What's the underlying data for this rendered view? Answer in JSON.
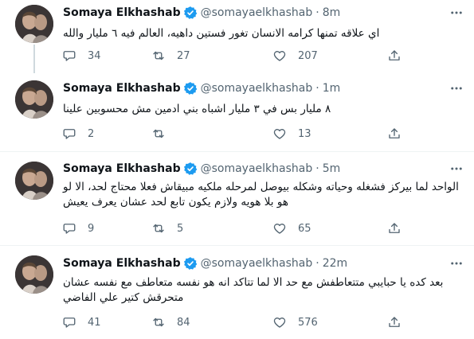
{
  "tweets": [
    {
      "name": "Somaya Elkhashab",
      "handle": "@somayaelkhashab",
      "dot": "·",
      "time": "8m",
      "text": "اي علاقه تمنها كرامه الانسان تغور فستين داهيه، العالم فيه ٦ مليار والله",
      "replies": "34",
      "retweets": "27",
      "likes": "207"
    },
    {
      "name": "Somaya Elkhashab",
      "handle": "@somayaelkhashab",
      "dot": "·",
      "time": "1m",
      "text": "٨ مليار بس في ٣ مليار اشباه بني ادمين مش محسوبين علينا",
      "replies": "2",
      "retweets": "",
      "likes": "13"
    },
    {
      "name": "Somaya Elkhashab",
      "handle": "@somayaelkhashab",
      "dot": "·",
      "time": "5m",
      "text": "الواحد لما بيركز فشغله وحياته وشكله بيوصل لمرحله ملكيه مبيقاش فعلا محتاج لحد، الا لو هو بلا هويه ولازم يكون تابع لحد عشان يعرف يعيش",
      "replies": "9",
      "retweets": "5",
      "likes": "65"
    },
    {
      "name": "Somaya Elkhashab",
      "handle": "@somayaelkhashab",
      "dot": "·",
      "time": "22m",
      "text": "بعد كده يا حبايبي متتعاطفش مع حد الا لما تتاكد انه هو نفسه متعاطف مع نفسه عشان متحرقش كتير علي الفاضي",
      "replies": "41",
      "retweets": "84",
      "likes": "576"
    }
  ],
  "icons": {
    "reply": "speech-bubble-icon",
    "retweet": "retweet-arrows-icon",
    "like": "heart-icon",
    "share": "share-upload-icon",
    "more": "more-dots-icon",
    "verified": "verified-badge-icon"
  },
  "colors": {
    "verified": "#1d9bf0",
    "secondary_text": "#536471",
    "divider": "#eff3f4",
    "thread_line": "#cfd9de"
  }
}
